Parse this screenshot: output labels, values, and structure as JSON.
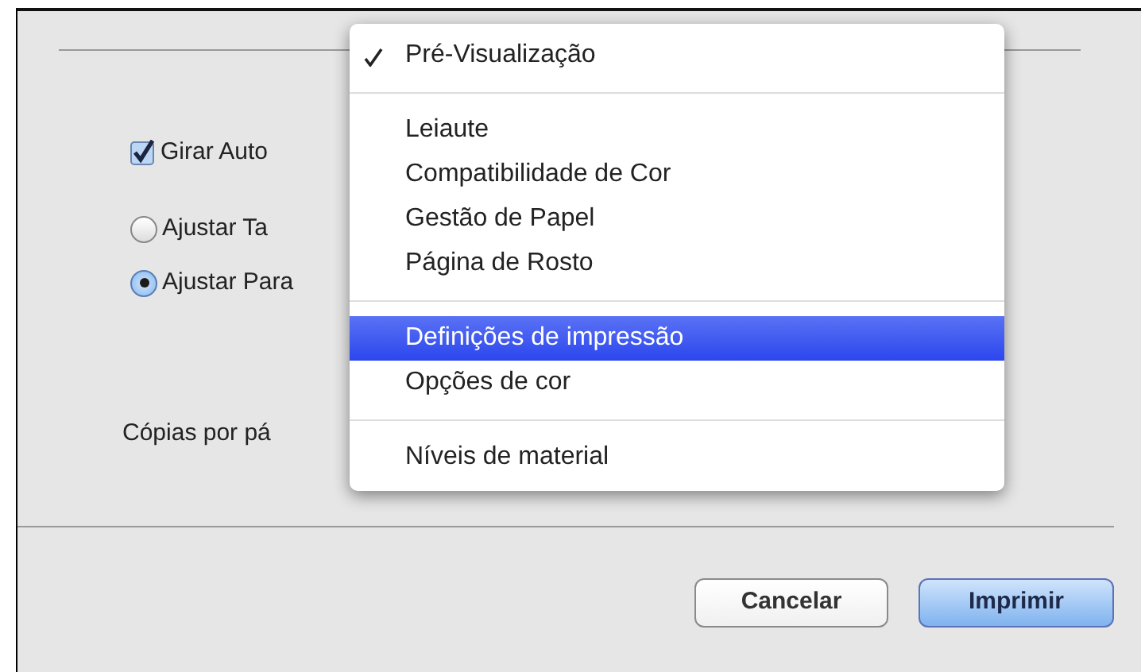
{
  "options": {
    "auto_rotate": {
      "label": "Girar Auto",
      "checked": true
    },
    "scaling": [
      {
        "label": "Ajustar Ta",
        "selected": false
      },
      {
        "label": "Ajustar Para",
        "selected": true
      }
    ],
    "copies_label": "Cópias por pá"
  },
  "menu": {
    "items": [
      {
        "kind": "item",
        "label": "Pré-Visualização",
        "checked": true,
        "selected": false
      },
      {
        "kind": "separator"
      },
      {
        "kind": "item",
        "label": "Leiaute",
        "checked": false,
        "selected": false
      },
      {
        "kind": "item",
        "label": "Compatibilidade de Cor",
        "checked": false,
        "selected": false
      },
      {
        "kind": "item",
        "label": "Gestão de Papel",
        "checked": false,
        "selected": false
      },
      {
        "kind": "item",
        "label": "Página de Rosto",
        "checked": false,
        "selected": false
      },
      {
        "kind": "separator"
      },
      {
        "kind": "item",
        "label": "Definições de impressão",
        "checked": false,
        "selected": true
      },
      {
        "kind": "item",
        "label": "Opções de cor",
        "checked": false,
        "selected": false
      },
      {
        "kind": "separator"
      },
      {
        "kind": "item",
        "label": "Níveis de material",
        "checked": false,
        "selected": false
      }
    ]
  },
  "buttons": [
    {
      "label": "Cancelar",
      "default": false
    },
    {
      "label": "Imprimir",
      "default": true
    }
  ]
}
